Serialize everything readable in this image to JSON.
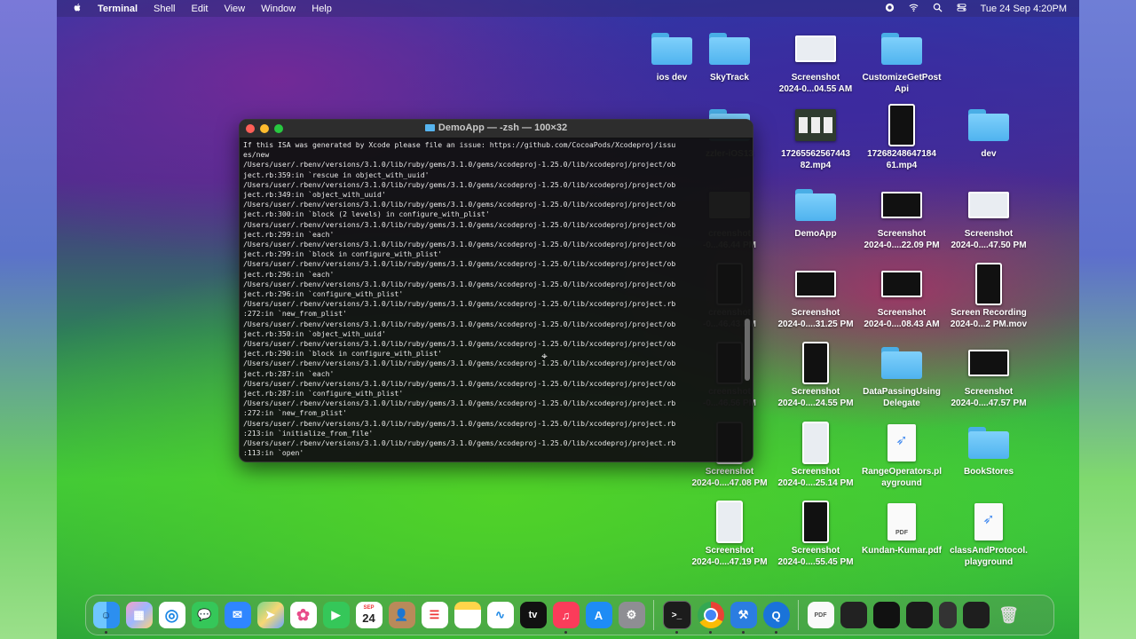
{
  "menubar": {
    "app": "Terminal",
    "items": [
      "Shell",
      "Edit",
      "View",
      "Window",
      "Help"
    ],
    "datetime": "Tue 24 Sep  4:20PM"
  },
  "terminal": {
    "title": "DemoApp — -zsh — 100×32",
    "lines": [
      "If this ISA was generated by Xcode please file an issue: https://github.com/CocoaPods/Xcodeproj/issu",
      "es/new",
      "/Users/user/.rbenv/versions/3.1.0/lib/ruby/gems/3.1.0/gems/xcodeproj-1.25.0/lib/xcodeproj/project/ob",
      "ject.rb:359:in `rescue in object_with_uuid'",
      "/Users/user/.rbenv/versions/3.1.0/lib/ruby/gems/3.1.0/gems/xcodeproj-1.25.0/lib/xcodeproj/project/ob",
      "ject.rb:349:in `object_with_uuid'",
      "/Users/user/.rbenv/versions/3.1.0/lib/ruby/gems/3.1.0/gems/xcodeproj-1.25.0/lib/xcodeproj/project/ob",
      "ject.rb:300:in `block (2 levels) in configure_with_plist'",
      "/Users/user/.rbenv/versions/3.1.0/lib/ruby/gems/3.1.0/gems/xcodeproj-1.25.0/lib/xcodeproj/project/ob",
      "ject.rb:299:in `each'",
      "/Users/user/.rbenv/versions/3.1.0/lib/ruby/gems/3.1.0/gems/xcodeproj-1.25.0/lib/xcodeproj/project/ob",
      "ject.rb:299:in `block in configure_with_plist'",
      "/Users/user/.rbenv/versions/3.1.0/lib/ruby/gems/3.1.0/gems/xcodeproj-1.25.0/lib/xcodeproj/project/ob",
      "ject.rb:296:in `each'",
      "/Users/user/.rbenv/versions/3.1.0/lib/ruby/gems/3.1.0/gems/xcodeproj-1.25.0/lib/xcodeproj/project/ob",
      "ject.rb:296:in `configure_with_plist'",
      "/Users/user/.rbenv/versions/3.1.0/lib/ruby/gems/3.1.0/gems/xcodeproj-1.25.0/lib/xcodeproj/project.rb",
      ":272:in `new_from_plist'",
      "/Users/user/.rbenv/versions/3.1.0/lib/ruby/gems/3.1.0/gems/xcodeproj-1.25.0/lib/xcodeproj/project/ob",
      "ject.rb:350:in `object_with_uuid'",
      "/Users/user/.rbenv/versions/3.1.0/lib/ruby/gems/3.1.0/gems/xcodeproj-1.25.0/lib/xcodeproj/project/ob",
      "ject.rb:290:in `block in configure_with_plist'",
      "/Users/user/.rbenv/versions/3.1.0/lib/ruby/gems/3.1.0/gems/xcodeproj-1.25.0/lib/xcodeproj/project/ob",
      "ject.rb:287:in `each'",
      "/Users/user/.rbenv/versions/3.1.0/lib/ruby/gems/3.1.0/gems/xcodeproj-1.25.0/lib/xcodeproj/project/ob",
      "ject.rb:287:in `configure_with_plist'",
      "/Users/user/.rbenv/versions/3.1.0/lib/ruby/gems/3.1.0/gems/xcodeproj-1.25.0/lib/xcodeproj/project.rb",
      ":272:in `new_from_plist'",
      "/Users/user/.rbenv/versions/3.1.0/lib/ruby/gems/3.1.0/gems/xcodeproj-1.25.0/lib/xcodeproj/project.rb",
      ":213:in `initialize_from_file'",
      "/Users/user/.rbenv/versions/3.1.0/lib/ruby/gems/3.1.0/gems/xcodeproj-1.25.0/lib/xcodeproj/project.rb",
      ":113:in `open'"
    ]
  },
  "desktop": {
    "icons": [
      {
        "label": "ios dev",
        "kind": "folder"
      },
      {
        "label": "SkyTrack",
        "kind": "folder"
      },
      {
        "label": "Screenshot\n2024-0...04.55 AM",
        "kind": "thumb-wide-light"
      },
      {
        "label": "CustomizeGetPost\nApi",
        "kind": "folder"
      },
      {
        "label": "zzler-iOS13",
        "kind": "folder"
      },
      {
        "label": "17265562567443\n82.mp4",
        "kind": "video"
      },
      {
        "label": "17268248647184\n61.mp4",
        "kind": "video-tall"
      },
      {
        "label": "dev",
        "kind": "folder"
      },
      {
        "label": "creenshot\n-0...46.44 PM",
        "kind": "thumb-wide-light"
      },
      {
        "label": "DemoApp",
        "kind": "folder"
      },
      {
        "label": "Screenshot\n2024-0....22.09 PM",
        "kind": "thumb-wide"
      },
      {
        "label": "Screenshot\n2024-0....47.50 PM",
        "kind": "thumb-wide-light"
      },
      {
        "label": "creenshot\n-0...46.43 PM",
        "kind": "thumb-tall"
      },
      {
        "label": "Screenshot\n2024-0....31.25 PM",
        "kind": "thumb-wide"
      },
      {
        "label": "Screenshot\n2024-0....08.43 AM",
        "kind": "thumb-wide"
      },
      {
        "label": "Screen Recording\n2024-0...2 PM.mov",
        "kind": "thumb-tall"
      },
      {
        "label": "creenshot\n-0...46.56 PM",
        "kind": "thumb-tall"
      },
      {
        "label": "Screenshot\n2024-0....24.55 PM",
        "kind": "thumb-tall"
      },
      {
        "label": "DataPassingUsing\nDelegate",
        "kind": "folder"
      },
      {
        "label": "Screenshot\n2024-0....47.57 PM",
        "kind": "thumb-wide"
      },
      {
        "label": "Screenshot\n2024-0....47.08 PM",
        "kind": "thumb-tall"
      },
      {
        "label": "Screenshot\n2024-0....25.14 PM",
        "kind": "thumb-tall-light"
      },
      {
        "label": "RangeOperators.pl\nayground",
        "kind": "swift"
      },
      {
        "label": "BookStores",
        "kind": "folder"
      },
      {
        "label": "Screenshot\n2024-0....47.19 PM",
        "kind": "thumb-tall-light"
      },
      {
        "label": "Screenshot\n2024-0....55.45 PM",
        "kind": "thumb-tall"
      },
      {
        "label": "Kundan-Kumar.pdf",
        "kind": "pdf"
      },
      {
        "label": "classAndProtocol.\nplayground",
        "kind": "swift"
      }
    ]
  },
  "dock": {
    "calendar_month": "SEP",
    "calendar_day": "24",
    "tv_label": "tv",
    "pdf_label": "PDF"
  },
  "colors": {
    "folder": "#56b4ef",
    "terminal_bg": "#121212",
    "close": "#fe5f57",
    "minimize": "#febc2e",
    "zoom": "#28c840"
  }
}
